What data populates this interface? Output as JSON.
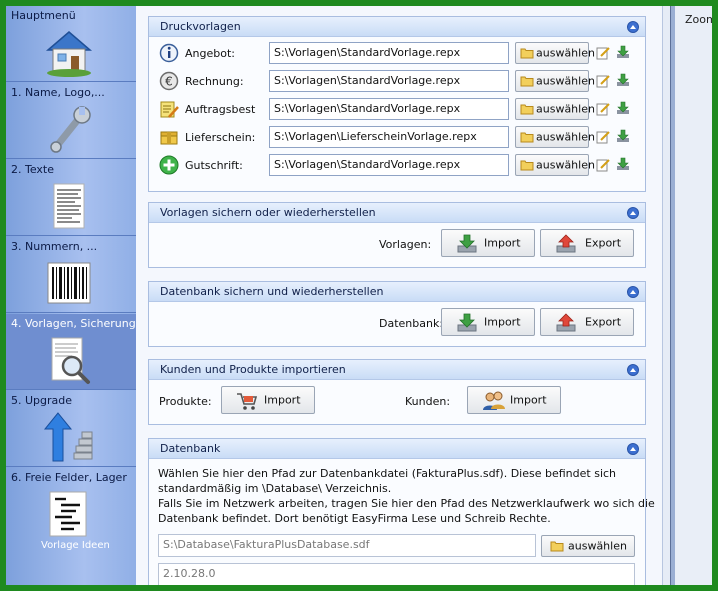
{
  "sidebar": {
    "items": [
      {
        "label": "Hauptmenü",
        "icon": "house-icon"
      },
      {
        "label": "1. Name, Logo,...",
        "icon": "wrench-icon"
      },
      {
        "label": "2. Texte",
        "icon": "text-document-icon"
      },
      {
        "label": "3. Nummern, ...",
        "icon": "barcode-icon"
      },
      {
        "label": "4. Vorlagen, Sicherung",
        "icon": "document-magnifier-icon"
      },
      {
        "label": "5. Upgrade",
        "icon": "upgrade-arrow-icon"
      },
      {
        "label": "6. Freie Felder, Lager",
        "icon": "list-document-icon"
      }
    ],
    "active_index": 4,
    "watermark": "Vorlage Ideen"
  },
  "right_pane": {
    "zoom_label": "Zoom"
  },
  "druckvorlagen": {
    "title": "Druckvorlagen",
    "rows": [
      {
        "label": "Angebot:",
        "path": "S:\\Vorlagen\\StandardVorlage.repx",
        "icon": "info-icon"
      },
      {
        "label": "Rechnung:",
        "path": "S:\\Vorlagen\\StandardVorlage.repx",
        "icon": "euro-icon"
      },
      {
        "label": "Auftragsbest",
        "path": "S:\\Vorlagen\\StandardVorlage.repx",
        "icon": "notepad-pencil-icon"
      },
      {
        "label": "Lieferschein:",
        "path": "S:\\Vorlagen\\LieferscheinVorlage.repx",
        "icon": "delivery-box-icon"
      },
      {
        "label": "Gutschrift:",
        "path": "S:\\Vorlagen\\StandardVorlage.repx",
        "icon": "plus-icon"
      }
    ],
    "browse_label": "auswählen"
  },
  "vorlagen_backup": {
    "title": "Vorlagen sichern oder wiederherstellen",
    "label": "Vorlagen:",
    "import_label": "Import",
    "export_label": "Export"
  },
  "datenbank_backup": {
    "title": "Datenbank sichern und wiederherstellen",
    "label": "Datenbank:",
    "import_label": "Import",
    "export_label": "Export"
  },
  "kunden_import": {
    "title": "Kunden und Produkte importieren",
    "produkte_label": "Produkte:",
    "produkte_button": "Import",
    "kunden_label": "Kunden:",
    "kunden_button": "Import"
  },
  "datenbank": {
    "title": "Datenbank",
    "lines": [
      "Wählen Sie hier den Pfad zur Datenbankdatei (FakturaPlus.sdf). Diese befindet sich",
      "standardmäßig im \\Database\\ Verzeichnis.",
      "Falls Sie im Netzwerk arbeiten, tragen Sie hier den Pfad des Netzwerklaufwerk wo sich die",
      "Datenbank befindet. Dort benötigt EasyFirma Lese und Schreib Rechte."
    ],
    "path": "S:\\Database\\FakturaPlusDatabase.sdf",
    "browse_label": "auswählen",
    "version": "2.10.28.0"
  }
}
